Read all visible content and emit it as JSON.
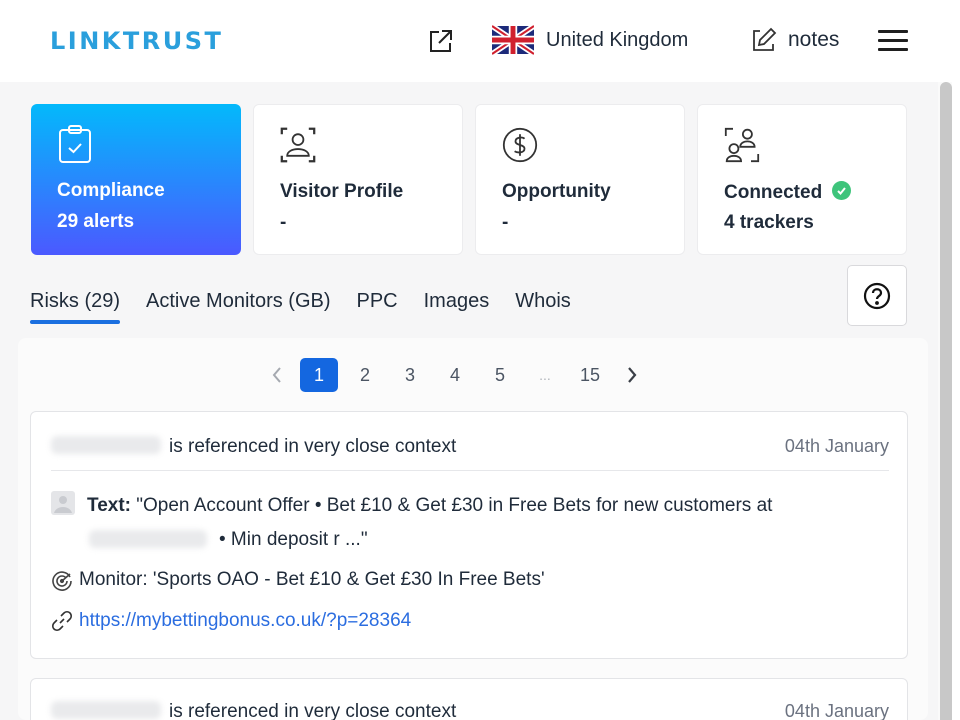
{
  "header": {
    "logo": "LINKTRUST",
    "external_link_icon": "external-link-icon",
    "country": {
      "label": "United Kingdom",
      "flag": "uk-flag-icon"
    },
    "notes_label": "notes",
    "menu_icon": "hamburger-menu-icon"
  },
  "cards": [
    {
      "title": "Compliance",
      "subtitle": "29 alerts",
      "icon": "clipboard-check-icon",
      "active": true
    },
    {
      "title": "Visitor Profile",
      "subtitle": "-",
      "icon": "user-scan-icon",
      "active": false
    },
    {
      "title": "Opportunity",
      "subtitle": "-",
      "icon": "dollar-circle-icon",
      "active": false
    },
    {
      "title": "Connected",
      "subtitle": "4 trackers",
      "icon": "users-scan-icon",
      "status_icon": "check-circle-icon",
      "active": false
    }
  ],
  "tabs": [
    {
      "label": "Risks (29)",
      "active": true
    },
    {
      "label": "Active Monitors (GB)",
      "active": false
    },
    {
      "label": "PPC",
      "active": false
    },
    {
      "label": "Images",
      "active": false
    },
    {
      "label": "Whois",
      "active": false
    }
  ],
  "help_icon": "question-circle-icon",
  "pagination": {
    "current": "1",
    "pages": [
      "1",
      "2",
      "3",
      "4",
      "5",
      "...",
      "15"
    ],
    "prev_icon": "chevron-left-icon",
    "next_icon": "chevron-right-icon"
  },
  "results": [
    {
      "title": "is referenced in very close context",
      "date": "04th January",
      "text_label": "Text:",
      "text_part1": "\"Open Account Offer • Bet £10 & Get £30 in Free Bets for new customers at",
      "text_part2": "• Min deposit r ...\"",
      "monitor": "Monitor: 'Sports OAO - Bet £10 & Get £30 In Free Bets'",
      "url": "https://mybettingbonus.co.uk/?p=28364"
    },
    {
      "title": "is referenced in very close context",
      "date": "04th January"
    }
  ],
  "colors": {
    "brand": "#2a9fdc",
    "accent_blue": "#1467e0",
    "gradient_top": "#03b9fb",
    "gradient_bottom": "#4b59ff",
    "success": "#3ec47b",
    "link": "#2b6de0"
  }
}
